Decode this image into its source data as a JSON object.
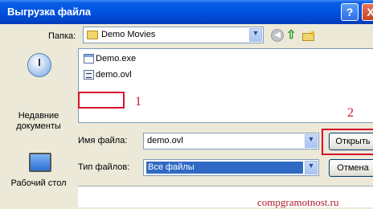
{
  "window": {
    "title": "Выгрузка файла",
    "help_label": "?",
    "close_label": "X"
  },
  "toolbar": {
    "folder_label": "Папка:",
    "folder_value": "Demo Movies"
  },
  "places": [
    {
      "label_line1": "Недавние",
      "label_line2": "документы"
    },
    {
      "label_line1": "Рабочий стол",
      "label_line2": ""
    }
  ],
  "files": [
    {
      "name": "Demo.exe",
      "icon": "exe-file-icon"
    },
    {
      "name": "demo.ovl",
      "icon": "ovl-file-icon"
    }
  ],
  "annotations": {
    "marker1": "1",
    "marker2": "2"
  },
  "form": {
    "filename_label": "Имя файла:",
    "filename_value": "demo.ovl",
    "filetype_label": "Тип файлов:",
    "filetype_value": "Все файлы"
  },
  "buttons": {
    "open": "Открыть",
    "cancel": "Отмена"
  },
  "watermark": "compgramotnost.ru",
  "colors": {
    "titlebar": "#0054e3",
    "selection": "#316ac5",
    "annotation_red": "#d8102a"
  }
}
